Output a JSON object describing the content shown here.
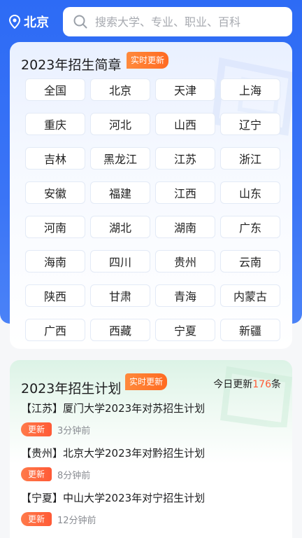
{
  "header": {
    "city": "北京",
    "search_placeholder": "搜索大学、专业、职业、百科"
  },
  "brief": {
    "title": "2023年招生简章",
    "badge": "实时更新",
    "provinces": [
      "全国",
      "北京",
      "天津",
      "上海",
      "重庆",
      "河北",
      "山西",
      "辽宁",
      "吉林",
      "黑龙江",
      "江苏",
      "浙江",
      "安徽",
      "福建",
      "江西",
      "山东",
      "河南",
      "湖北",
      "湖南",
      "广东",
      "海南",
      "四川",
      "贵州",
      "云南",
      "陕西",
      "甘肃",
      "青海",
      "内蒙古",
      "广西",
      "西藏",
      "宁夏",
      "新疆"
    ]
  },
  "plan": {
    "title": "2023年招生计划",
    "badge": "实时更新",
    "today_prefix": "今日更新",
    "today_count": "176",
    "today_suffix": "条",
    "items": [
      {
        "title": "【江苏】厦门大学2023年对苏招生计划",
        "tag": "更新",
        "time": "3分钟前"
      },
      {
        "title": "【贵州】北京大学2023年对黔招生计划",
        "tag": "更新",
        "time": "8分钟前"
      },
      {
        "title": "【宁夏】中山大学2023年对宁招生计划",
        "tag": "更新",
        "time": "12分钟前"
      }
    ]
  },
  "colors": {
    "brand": "#2d6bf5",
    "badge_orange": "#ff6a21",
    "highlight": "#ff5a36"
  },
  "icons": {
    "location": "location-pin-icon",
    "search": "search-icon"
  }
}
